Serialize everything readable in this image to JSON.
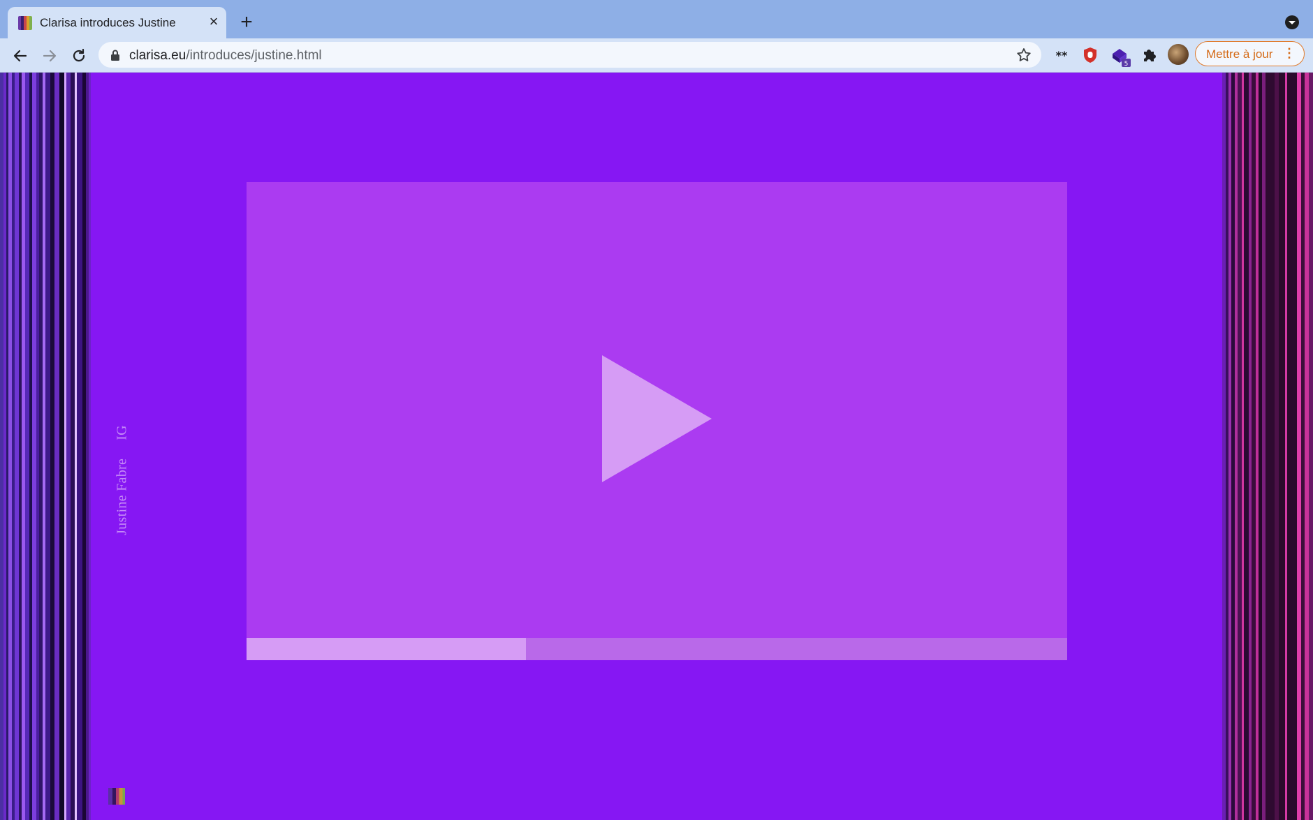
{
  "browser": {
    "tab_title": "Clarisa introduces Justine",
    "tab_close": "×",
    "new_tab": "+",
    "url_host": "clarisa.eu",
    "url_path": "/introduces/justine.html",
    "update_button": "Mettre à jour",
    "update_menu": "⋮",
    "extension_badge": "5"
  },
  "page": {
    "author_name": "Justine Fabre",
    "ig_link": "IG",
    "video_progress_fraction": 0.34
  },
  "colors": {
    "page_background": "#8617f3",
    "video_background": "#ab3bf1",
    "play_icon": "#d69cf5",
    "progress_fill": "#d69cf5",
    "progress_track": "#b969e9",
    "label_text": "#c58af6"
  }
}
